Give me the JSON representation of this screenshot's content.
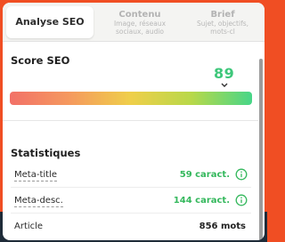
{
  "tabs": [
    {
      "title": "Analyse SEO",
      "subtitle": ""
    },
    {
      "title": "Contenu",
      "subtitle_line1": "Image, réseaux",
      "subtitle_line2": "sociaux, audio"
    },
    {
      "title": "Brief",
      "subtitle_line1": "Sujet, objectifs,",
      "subtitle_line2": "mots-cl"
    }
  ],
  "score": {
    "title": "Score SEO",
    "value": "89",
    "bar_colors": [
      "#f27168",
      "#efcf4a",
      "#47d688"
    ]
  },
  "stats": {
    "title": "Statistiques",
    "rows": [
      {
        "label": "Meta-title",
        "value": "59 caract."
      },
      {
        "label": "Meta-desc.",
        "value": "144 caract."
      },
      {
        "label": "Article",
        "value": "856 mots"
      }
    ]
  },
  "colors": {
    "accent_green": "#35b85d",
    "frame_orange": "#f04e23"
  }
}
